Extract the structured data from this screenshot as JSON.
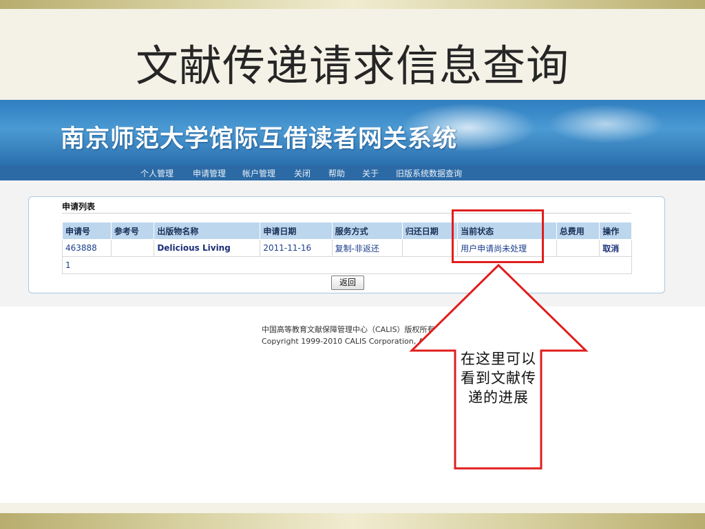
{
  "slide": {
    "title": "文献传递请求信息查询",
    "callout": "在这里可以看到文献传递的进展"
  },
  "app": {
    "banner_title": "南京师范大学馆际互借读者网关系统",
    "nav": [
      "个人管理",
      "申请管理",
      "帐户管理",
      "关闭",
      "帮助",
      "关于",
      "旧版系统数据查询"
    ]
  },
  "panel": {
    "heading": "申请列表",
    "columns": [
      "申请号",
      "参考号",
      "出版物名称",
      "申请日期",
      "服务方式",
      "归还日期",
      "当前状态",
      "总费用",
      "操作"
    ],
    "rows": [
      {
        "request_no": "463888",
        "reference_no": "",
        "publication": "Delicious Living",
        "request_date": "2011-11-16",
        "service": "复制-非返还",
        "return_date": "",
        "status": "用户申请尚未处理",
        "fee": "",
        "action": "取消"
      }
    ],
    "page_number": "1",
    "return_button": "返回"
  },
  "footer": {
    "line1": "中国高等教育文献保障管理中心（CALIS）版权所有",
    "line2": "Copyright 1999-2010 CALIS Corporation, All RightsReserved"
  },
  "colors": {
    "highlight": "#e11d1d",
    "banner": "#2f7ec0",
    "navbar": "#2c6aa5",
    "table_header": "#bcd6ee"
  }
}
